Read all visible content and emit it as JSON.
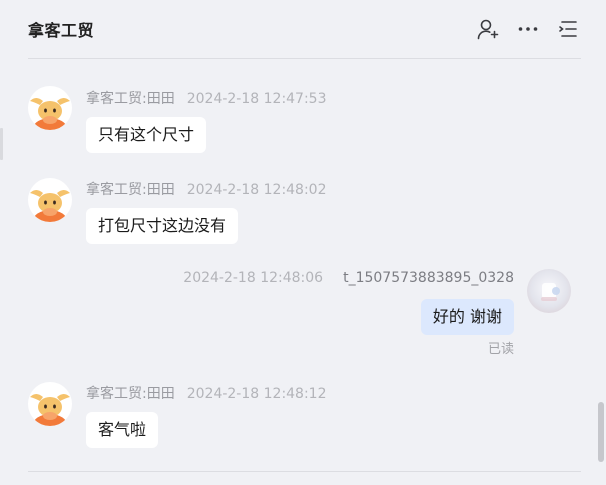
{
  "header": {
    "title": "拿客工贸",
    "actions": [
      "add-member-icon",
      "more-icon",
      "menu-list-icon"
    ]
  },
  "messages": [
    {
      "sender": "拿客工贸:田田",
      "time": "2024-2-18 12:47:53",
      "text": "只有这个尺寸",
      "mine": false
    },
    {
      "sender": "拿客工贸:田田",
      "time": "2024-2-18 12:48:02",
      "text": "打包尺寸这边没有",
      "mine": false
    },
    {
      "sender": "t_1507573883895_0328",
      "time": "2024-2-18 12:48:06",
      "text": "好的 谢谢",
      "mine": true,
      "status": "已读"
    },
    {
      "sender": "拿客工贸:田田",
      "time": "2024-2-18 12:48:12",
      "text": "客气啦",
      "mine": false
    }
  ],
  "colors": {
    "background": "#f0f1f5",
    "bubble_other": "#ffffff",
    "bubble_mine": "#dce8fd",
    "avatar_bull_orange": "#f27a3a"
  }
}
